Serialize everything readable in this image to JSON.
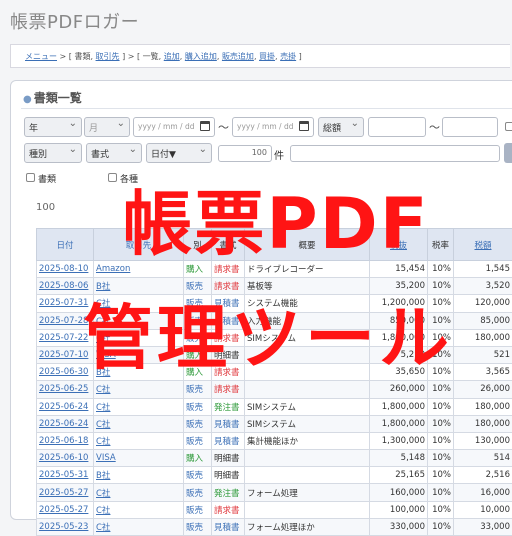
{
  "app": {
    "title": "帳票PDFロガー"
  },
  "breadcrumb": {
    "menu": "メニュー",
    "sep1": " > [ 書類, ",
    "client": "取引先",
    "sep2": " ] > [ 一覧, ",
    "add": "追加",
    "c1": ", ",
    "purchase_add": "購入追加",
    "c2": ", ",
    "sales_add": "販売追加",
    "c3": ", ",
    "buy": "買掛",
    "c4": ", ",
    "sell": "売掛",
    "end": " ]"
  },
  "panel": {
    "title": "書類一覧"
  },
  "filters": {
    "year": "年",
    "month": "月",
    "date_from_placeholder": "yyyy / mm / dd",
    "tilde1": "〜",
    "date_to_placeholder": "yyyy / mm / dd",
    "amount_type": "総額",
    "tilde2": "〜",
    "type": "種別",
    "format": "書式",
    "date_sort": "日付▼",
    "limit": "100",
    "unit": "件"
  },
  "options": {
    "opt1": "書類",
    "opt2": "各種"
  },
  "summary": {
    "count_prefix": "100"
  },
  "table": {
    "headers": [
      "日付",
      "取引先",
      "別",
      "書式",
      "概要",
      "税抜",
      "税率",
      "税額"
    ],
    "rows": [
      {
        "date": "2025-08-10",
        "client": "Amazon",
        "kind": "購入",
        "kclass": "kind-buy",
        "type": "請求書",
        "tclass": "t-invoice",
        "summary": "ドライブレコーダー",
        "net": "15,454",
        "rate": "10%",
        "tax": "1,545"
      },
      {
        "date": "2025-08-06",
        "client": "B社",
        "kind": "販売",
        "kclass": "kind-sell",
        "type": "請求書",
        "tclass": "t-invoice",
        "summary": "基板等",
        "net": "35,200",
        "rate": "10%",
        "tax": "3,520"
      },
      {
        "date": "2025-07-31",
        "client": "C社",
        "kind": "販売",
        "kclass": "kind-sell",
        "type": "見積書",
        "tclass": "t-estimate",
        "summary": "システム機能",
        "net": "1,200,000",
        "rate": "10%",
        "tax": "120,000"
      },
      {
        "date": "2025-07-28",
        "client": "C社",
        "kind": "販売",
        "kclass": "kind-sell",
        "type": "見積書",
        "tclass": "t-estimate",
        "summary": "入力機能",
        "net": "850,000",
        "rate": "10%",
        "tax": "85,000"
      },
      {
        "date": "2025-07-22",
        "client": "C社",
        "kind": "販売",
        "kclass": "kind-sell",
        "type": "請求書",
        "tclass": "t-invoice",
        "summary": "SIMシステム",
        "net": "1,800,000",
        "rate": "10%",
        "tax": "180,000"
      },
      {
        "date": "2025-07-10",
        "client": "VISA",
        "kind": "購入",
        "kclass": "kind-buy",
        "type": "明細書",
        "tclass": "t-statement",
        "summary": "",
        "net": "5,210",
        "rate": "10%",
        "tax": "521"
      },
      {
        "date": "2025-06-30",
        "client": "B社",
        "kind": "購入",
        "kclass": "kind-buy",
        "type": "請求書",
        "tclass": "t-invoice",
        "summary": "",
        "net": "35,650",
        "rate": "10%",
        "tax": "3,565"
      },
      {
        "date": "2025-06-25",
        "client": "C社",
        "kind": "販売",
        "kclass": "kind-sell",
        "type": "請求書",
        "tclass": "t-invoice",
        "summary": "",
        "net": "260,000",
        "rate": "10%",
        "tax": "26,000"
      },
      {
        "date": "2025-06-24",
        "client": "C社",
        "kind": "販売",
        "kclass": "kind-sell",
        "type": "発注書",
        "tclass": "t-order",
        "summary": "SIMシステム",
        "net": "1,800,000",
        "rate": "10%",
        "tax": "180,000"
      },
      {
        "date": "2025-06-24",
        "client": "C社",
        "kind": "販売",
        "kclass": "kind-sell",
        "type": "見積書",
        "tclass": "t-estimate",
        "summary": "SIMシステム",
        "net": "1,800,000",
        "rate": "10%",
        "tax": "180,000"
      },
      {
        "date": "2025-06-18",
        "client": "C社",
        "kind": "販売",
        "kclass": "kind-sell",
        "type": "見積書",
        "tclass": "t-estimate",
        "summary": "集計機能ほか",
        "net": "1,300,000",
        "rate": "10%",
        "tax": "130,000"
      },
      {
        "date": "2025-06-10",
        "client": "VISA",
        "kind": "購入",
        "kclass": "kind-buy",
        "type": "明細書",
        "tclass": "t-statement",
        "summary": "",
        "net": "5,148",
        "rate": "10%",
        "tax": "514"
      },
      {
        "date": "2025-05-31",
        "client": "B社",
        "kind": "販売",
        "kclass": "kind-sell",
        "type": "明細書",
        "tclass": "t-statement",
        "summary": "",
        "net": "25,165",
        "rate": "10%",
        "tax": "2,516"
      },
      {
        "date": "2025-05-27",
        "client": "C社",
        "kind": "販売",
        "kclass": "kind-sell",
        "type": "発注書",
        "tclass": "t-order",
        "summary": "フォーム処理",
        "net": "160,000",
        "rate": "10%",
        "tax": "16,000"
      },
      {
        "date": "2025-05-27",
        "client": "C社",
        "kind": "販売",
        "kclass": "kind-sell",
        "type": "請求書",
        "tclass": "t-invoice",
        "summary": "",
        "net": "100,000",
        "rate": "10%",
        "tax": "10,000"
      },
      {
        "date": "2025-05-23",
        "client": "C社",
        "kind": "販売",
        "kclass": "kind-sell",
        "type": "見積書",
        "tclass": "t-estimate",
        "summary": "フォーム処理ほか",
        "net": "330,000",
        "rate": "10%",
        "tax": "33,000"
      }
    ]
  },
  "overlay": {
    "line1": "帳票PDF",
    "line2": "管理ツール"
  },
  "colors": {
    "overlay": "#ff1414",
    "link": "#3b6fb6",
    "buy": "#2e9a3a",
    "invoice": "#e0393e"
  }
}
